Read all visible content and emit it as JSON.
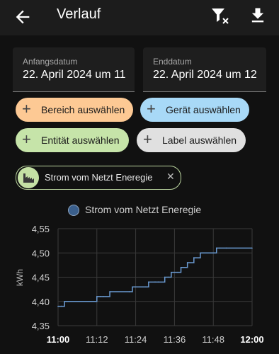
{
  "topbar": {
    "back_icon": "arrow-left-icon",
    "title": "Verlauf",
    "filter_icon": "filter-remove-icon",
    "download_icon": "download-icon"
  },
  "fields": {
    "start": {
      "label": "Anfangsdatum",
      "value": "22. April 2024 um 11"
    },
    "end": {
      "label": "Enddatum",
      "value": "22. April 2024 um 12"
    }
  },
  "chips": [
    {
      "label": "Bereich auswählen",
      "color": "#fdc994"
    },
    {
      "label": "Gerät auswählen",
      "color": "#a8d9f7"
    },
    {
      "label": "Entität auswählen",
      "color": "#c6e4a9"
    },
    {
      "label": "Label auswählen",
      "color": "#e0e0e0"
    }
  ],
  "selected": {
    "label": "Strom vom Netzt Eneregie",
    "icon": "energy-factory-icon",
    "remove_icon": "close-icon"
  },
  "chart_data": {
    "type": "line",
    "legend": "Strom vom Netzt Eneregie",
    "ylabel": "kWh",
    "ylim": [
      4.35,
      4.55
    ],
    "yticks": [
      "4,55",
      "4,50",
      "4,45",
      "4,40",
      "4,35"
    ],
    "xticks": [
      "11:00",
      "11:12",
      "11:24",
      "11:36",
      "11:48",
      "12:00"
    ],
    "x": [
      "11:00",
      "11:01",
      "11:02",
      "11:05",
      "11:09",
      "11:10",
      "11:12",
      "11:13",
      "11:14",
      "11:16",
      "11:22",
      "11:23",
      "11:25",
      "11:27",
      "11:28",
      "11:30",
      "11:31",
      "11:33",
      "11:34",
      "11:35",
      "11:37",
      "11:38",
      "11:40",
      "11:42",
      "11:44",
      "11:46",
      "11:47",
      "11:49",
      "11:50",
      "11:52",
      "12:00"
    ],
    "y": [
      4.39,
      4.39,
      4.4,
      4.4,
      4.4,
      4.4,
      4.41,
      4.41,
      4.41,
      4.42,
      4.42,
      4.43,
      4.43,
      4.43,
      4.44,
      4.44,
      4.44,
      4.45,
      4.45,
      4.46,
      4.46,
      4.47,
      4.48,
      4.49,
      4.5,
      4.5,
      4.5,
      4.51,
      4.51,
      4.51,
      4.51
    ],
    "series_color": "#6b9bd2",
    "grid": true
  }
}
